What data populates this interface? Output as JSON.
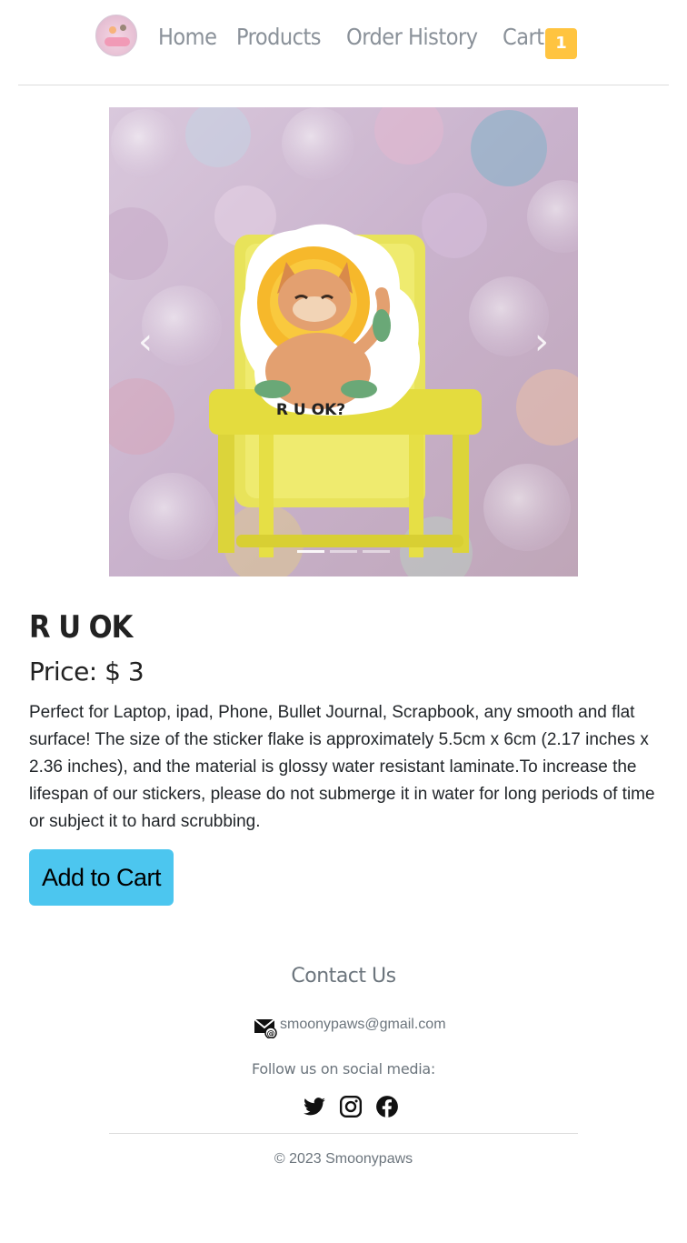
{
  "nav": {
    "links": [
      "Home",
      "Products",
      "Order History",
      "Cart"
    ],
    "cart_count": "1"
  },
  "carousel": {
    "slide_count": 3,
    "active_index": 0,
    "sticker_text": "R U OK?"
  },
  "product": {
    "name": "R U OK",
    "price_label": "Price:",
    "price_value": "$ 3",
    "description": "Perfect for Laptop, ipad, Phone, Bullet Journal, Scrapbook, any smooth and flat surface! The size of the sticker flake is approximately 5.5cm x 6cm (2.17 inches x 2.36 inches), and the material is glossy water resistant laminate.To increase the lifespan of our stickers, please do not submerge it in water for long periods of time or subject it to hard scrubbing.",
    "add_to_cart": "Add to Cart"
  },
  "footer": {
    "contact_title": "Contact Us",
    "email": "smoonypaws@gmail.com",
    "follow_text": "Follow us on social media:",
    "social": [
      "twitter-icon",
      "instagram-icon",
      "facebook-icon"
    ],
    "copyright": "© 2023 Smoonypaws"
  },
  "colors": {
    "accent_button": "#4cc6ef",
    "cart_badge": "#ffc440",
    "nav_text": "#8a9199"
  }
}
